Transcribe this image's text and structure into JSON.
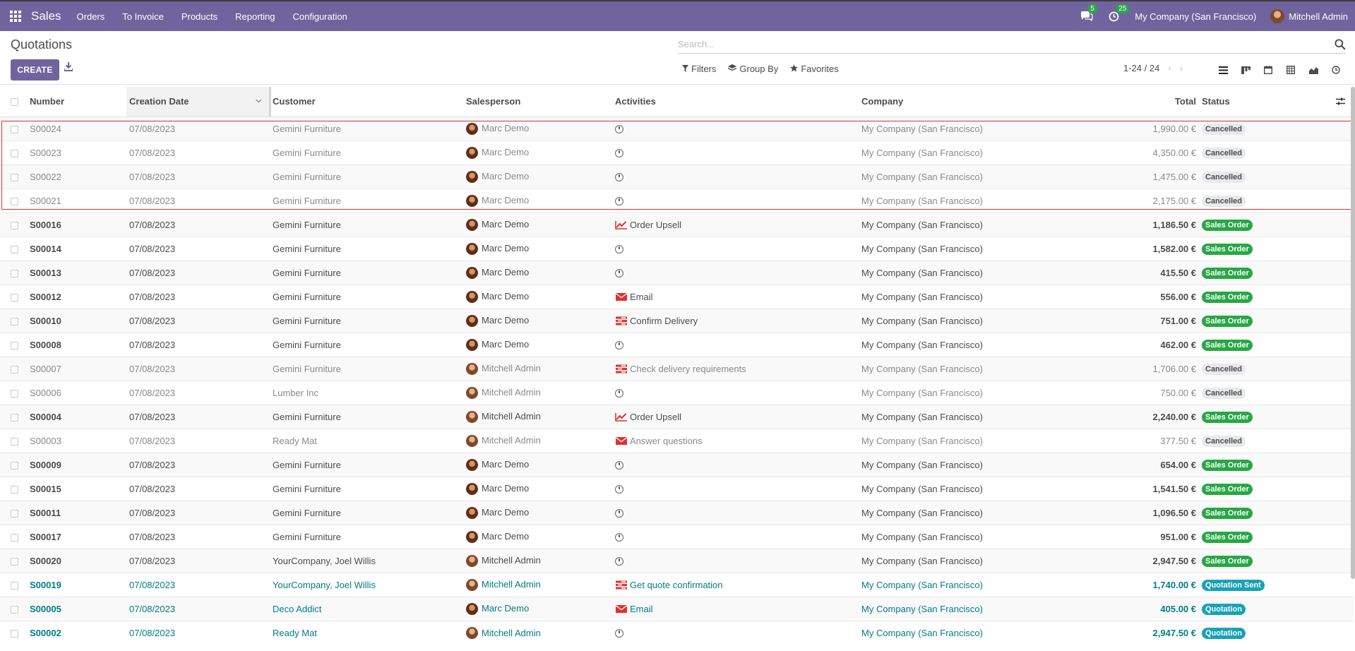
{
  "navbar": {
    "app_name": "Sales",
    "menus": [
      "Orders",
      "To Invoice",
      "Products",
      "Reporting",
      "Configuration"
    ],
    "messages_count": "5",
    "activities_count": "25",
    "company": "My Company (San Francisco)",
    "user": "Mitchell Admin"
  },
  "control_panel": {
    "breadcrumb": "Quotations",
    "create_label": "CREATE",
    "search_placeholder": "Search...",
    "filters_label": "Filters",
    "groupby_label": "Group By",
    "favorites_label": "Favorites",
    "pager": "1-24 / 24"
  },
  "colors": {
    "brand": "#71639e",
    "sales_order": "#28a745",
    "quotation": "#17a2b8",
    "selection": "#e03131"
  },
  "table": {
    "headers": {
      "number": "Number",
      "creation_date": "Creation Date",
      "customer": "Customer",
      "salesperson": "Salesperson",
      "activities": "Activities",
      "company": "Company",
      "total": "Total",
      "status": "Status"
    },
    "rows": [
      {
        "number": "S00024",
        "date": "07/08/2023",
        "customer": "Gemini Furniture",
        "salesperson": "Marc Demo",
        "activity": "",
        "activity_icon": "clock-icon",
        "company": "My Company (San Francisco)",
        "total": "1,990.00 €",
        "status": "Cancelled",
        "state": "cancelled"
      },
      {
        "number": "S00023",
        "date": "07/08/2023",
        "customer": "Gemini Furniture",
        "salesperson": "Marc Demo",
        "activity": "",
        "activity_icon": "clock-icon",
        "company": "My Company (San Francisco)",
        "total": "4,350.00 €",
        "status": "Cancelled",
        "state": "cancelled"
      },
      {
        "number": "S00022",
        "date": "07/08/2023",
        "customer": "Gemini Furniture",
        "salesperson": "Marc Demo",
        "activity": "",
        "activity_icon": "clock-icon",
        "company": "My Company (San Francisco)",
        "total": "1,475.00 €",
        "status": "Cancelled",
        "state": "cancelled"
      },
      {
        "number": "S00021",
        "date": "07/08/2023",
        "customer": "Gemini Furniture",
        "salesperson": "Marc Demo",
        "activity": "",
        "activity_icon": "clock-icon",
        "company": "My Company (San Francisco)",
        "total": "2,175.00 €",
        "status": "Cancelled",
        "state": "cancelled"
      },
      {
        "number": "S00016",
        "date": "07/08/2023",
        "customer": "Gemini Furniture",
        "salesperson": "Marc Demo",
        "activity": "Order Upsell",
        "activity_icon": "chart-line-icon",
        "company": "My Company (San Francisco)",
        "total": "1,186.50 €",
        "status": "Sales Order",
        "state": "sale"
      },
      {
        "number": "S00014",
        "date": "07/08/2023",
        "customer": "Gemini Furniture",
        "salesperson": "Marc Demo",
        "activity": "",
        "activity_icon": "clock-icon",
        "company": "My Company (San Francisco)",
        "total": "1,582.00 €",
        "status": "Sales Order",
        "state": "sale"
      },
      {
        "number": "S00013",
        "date": "07/08/2023",
        "customer": "Gemini Furniture",
        "salesperson": "Marc Demo",
        "activity": "",
        "activity_icon": "clock-icon",
        "company": "My Company (San Francisco)",
        "total": "415.50 €",
        "status": "Sales Order",
        "state": "sale"
      },
      {
        "number": "S00012",
        "date": "07/08/2023",
        "customer": "Gemini Furniture",
        "salesperson": "Marc Demo",
        "activity": "Email",
        "activity_icon": "envelope-icon",
        "company": "My Company (San Francisco)",
        "total": "556.00 €",
        "status": "Sales Order",
        "state": "sale"
      },
      {
        "number": "S00010",
        "date": "07/08/2023",
        "customer": "Gemini Furniture",
        "salesperson": "Marc Demo",
        "activity": "Confirm Delivery",
        "activity_icon": "tasks-icon",
        "company": "My Company (San Francisco)",
        "total": "751.00 €",
        "status": "Sales Order",
        "state": "sale"
      },
      {
        "number": "S00008",
        "date": "07/08/2023",
        "customer": "Gemini Furniture",
        "salesperson": "Marc Demo",
        "activity": "",
        "activity_icon": "clock-icon",
        "company": "My Company (San Francisco)",
        "total": "462.00 €",
        "status": "Sales Order",
        "state": "sale"
      },
      {
        "number": "S00007",
        "date": "07/08/2023",
        "customer": "Gemini Furniture",
        "salesperson": "Mitchell Admin",
        "activity": "Check delivery requirements",
        "activity_icon": "tasks-icon",
        "company": "My Company (San Francisco)",
        "total": "1,706.00 €",
        "status": "Cancelled",
        "state": "cancelled"
      },
      {
        "number": "S00006",
        "date": "07/08/2023",
        "customer": "Lumber Inc",
        "salesperson": "Mitchell Admin",
        "activity": "",
        "activity_icon": "clock-icon",
        "company": "My Company (San Francisco)",
        "total": "750.00 €",
        "status": "Cancelled",
        "state": "cancelled"
      },
      {
        "number": "S00004",
        "date": "07/08/2023",
        "customer": "Gemini Furniture",
        "salesperson": "Mitchell Admin",
        "activity": "Order Upsell",
        "activity_icon": "chart-line-icon",
        "company": "My Company (San Francisco)",
        "total": "2,240.00 €",
        "status": "Sales Order",
        "state": "sale"
      },
      {
        "number": "S00003",
        "date": "07/08/2023",
        "customer": "Ready Mat",
        "salesperson": "Mitchell Admin",
        "activity": "Answer questions",
        "activity_icon": "envelope-icon",
        "company": "My Company (San Francisco)",
        "total": "377.50 €",
        "status": "Cancelled",
        "state": "cancelled"
      },
      {
        "number": "S00009",
        "date": "07/08/2023",
        "customer": "Gemini Furniture",
        "salesperson": "Marc Demo",
        "activity": "",
        "activity_icon": "clock-icon",
        "company": "My Company (San Francisco)",
        "total": "654.00 €",
        "status": "Sales Order",
        "state": "sale"
      },
      {
        "number": "S00015",
        "date": "07/08/2023",
        "customer": "Gemini Furniture",
        "salesperson": "Marc Demo",
        "activity": "",
        "activity_icon": "clock-icon",
        "company": "My Company (San Francisco)",
        "total": "1,541.50 €",
        "status": "Sales Order",
        "state": "sale"
      },
      {
        "number": "S00011",
        "date": "07/08/2023",
        "customer": "Gemini Furniture",
        "salesperson": "Marc Demo",
        "activity": "",
        "activity_icon": "clock-icon",
        "company": "My Company (San Francisco)",
        "total": "1,096.50 €",
        "status": "Sales Order",
        "state": "sale"
      },
      {
        "number": "S00017",
        "date": "07/08/2023",
        "customer": "Gemini Furniture",
        "salesperson": "Marc Demo",
        "activity": "",
        "activity_icon": "clock-icon",
        "company": "My Company (San Francisco)",
        "total": "951.00 €",
        "status": "Sales Order",
        "state": "sale"
      },
      {
        "number": "S00020",
        "date": "07/08/2023",
        "customer": "YourCompany, Joel Willis",
        "salesperson": "Mitchell Admin",
        "activity": "",
        "activity_icon": "clock-icon",
        "company": "My Company (San Francisco)",
        "total": "2,947.50 €",
        "status": "Sales Order",
        "state": "sale"
      },
      {
        "number": "S00019",
        "date": "07/08/2023",
        "customer": "YourCompany, Joel Willis",
        "salesperson": "Mitchell Admin",
        "activity": "Get quote confirmation",
        "activity_icon": "tasks-icon",
        "company": "My Company (San Francisco)",
        "total": "1,740.00 €",
        "status": "Quotation Sent",
        "state": "draft"
      },
      {
        "number": "S00005",
        "date": "07/08/2023",
        "customer": "Deco Addict",
        "salesperson": "Marc Demo",
        "activity": "Email",
        "activity_icon": "envelope-icon",
        "company": "My Company (San Francisco)",
        "total": "405.00 €",
        "status": "Quotation",
        "state": "draft"
      },
      {
        "number": "S00002",
        "date": "07/08/2023",
        "customer": "Ready Mat",
        "salesperson": "Mitchell Admin",
        "activity": "",
        "activity_icon": "clock-icon",
        "company": "My Company (San Francisco)",
        "total": "2,947.50 €",
        "status": "Quotation",
        "state": "draft"
      }
    ]
  }
}
